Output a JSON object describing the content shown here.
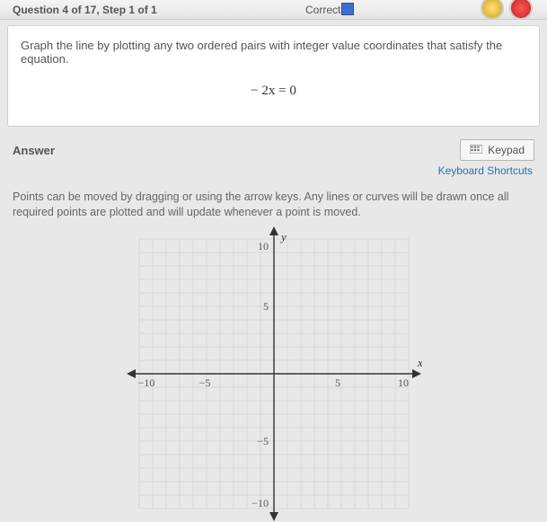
{
  "topbar": {
    "title": "Question 4 of 17, Step 1 of 1",
    "correct_label": "Correct"
  },
  "question": {
    "prompt": "Graph the line by plotting any two ordered pairs with integer value coordinates that satisfy the equation.",
    "equation": "− 2x = 0"
  },
  "answer": {
    "heading": "Answer",
    "keypad_label": "Keypad",
    "shortcuts_label": "Keyboard Shortcuts",
    "instructions": "Points can be moved by dragging or using the arrow keys. Any lines or curves will be drawn once all required points are plotted and will update whenever a point is moved."
  },
  "chart_data": {
    "type": "scatter",
    "title": "",
    "xlabel": "x",
    "ylabel": "y",
    "xlim": [
      -10,
      10
    ],
    "ylim": [
      -10,
      10
    ],
    "x_ticks": [
      -10,
      -5,
      5,
      10
    ],
    "y_ticks": [
      -10,
      -5,
      5,
      10
    ],
    "grid_step": 1,
    "series": []
  }
}
